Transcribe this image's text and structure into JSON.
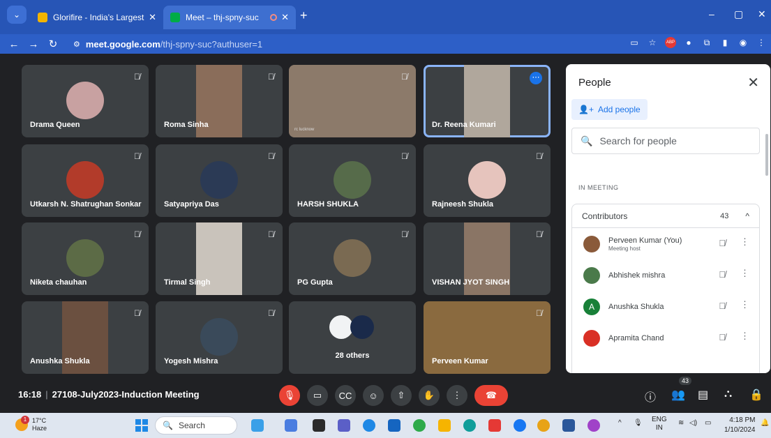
{
  "browser": {
    "tabs": [
      {
        "title": "Glorifire - India's Largest Online",
        "favicon_color": "#f2b400"
      },
      {
        "title": "Meet – thj-spny-suc",
        "favicon_color": "#00ac47"
      }
    ],
    "url_host": "meet.google.com",
    "url_path": "/thj-spny-suc?authuser=1",
    "extension_badge": "ABP"
  },
  "grid": {
    "tiles": [
      {
        "name": "Drama Queen",
        "kind": "avatar",
        "color": "#c8a1a1"
      },
      {
        "name": "Roma Sinha",
        "kind": "video",
        "color": "#8a6d5a"
      },
      {
        "name": "",
        "kind": "video-wide",
        "color": "#8c7a6a",
        "caption": "rc lucknow"
      },
      {
        "name": "Dr. Reena Kumari",
        "kind": "video",
        "color": "#b0a79c",
        "active": true
      },
      {
        "name": "Utkarsh N. Shatrughan Sonkar",
        "kind": "avatar",
        "color": "#b23b2a"
      },
      {
        "name": "Satyapriya Das",
        "kind": "avatar",
        "color": "#2b3a55"
      },
      {
        "name": "HARSH SHUKLA",
        "kind": "avatar",
        "color": "#566b4a"
      },
      {
        "name": "Rajneesh Shukla",
        "kind": "avatar",
        "color": "#e6c4bd"
      },
      {
        "name": "Niketa chauhan",
        "kind": "avatar",
        "color": "#5c6b46"
      },
      {
        "name": "Tirmal Singh",
        "kind": "video",
        "color": "#c9c3bb"
      },
      {
        "name": "PG Gupta",
        "kind": "avatar",
        "color": "#7a6a52"
      },
      {
        "name": "VISHAN JYOT SINGH",
        "kind": "video",
        "color": "#8a7565"
      },
      {
        "name": "Anushka Shukla",
        "kind": "video",
        "color": "#6b5040"
      },
      {
        "name": "Yogesh Mishra",
        "kind": "avatar",
        "color": "#3a4a5a"
      },
      {
        "name": "28 others",
        "kind": "others",
        "color": "#3c4043"
      },
      {
        "name": "Perveen Kumar",
        "kind": "video-wide",
        "color": "#8a6a3f"
      }
    ]
  },
  "people": {
    "title": "People",
    "add_label": "Add people",
    "search_placeholder": "Search for people",
    "in_meeting": "IN MEETING",
    "section": "Contributors",
    "count": "43",
    "list": [
      {
        "name": "Perveen Kumar (You)",
        "role": "Meeting host",
        "avatar_color": "#8a5a3a",
        "initial": ""
      },
      {
        "name": "Abhishek mishra",
        "role": "",
        "avatar_color": "#4a7a4a",
        "initial": ""
      },
      {
        "name": "Anushka Shukla",
        "role": "",
        "avatar_color": "#188038",
        "initial": "A"
      },
      {
        "name": "Apramita Chand",
        "role": "",
        "avatar_color": "#d93025",
        "initial": ""
      }
    ]
  },
  "bottom": {
    "time": "16:18",
    "meeting_name": "27108-July2023-Induction Meeting",
    "people_badge": "43"
  },
  "taskbar": {
    "temp": "17°C",
    "condition": "Haze",
    "search": "Search",
    "lang1": "ENG",
    "lang2": "IN",
    "time": "4:18 PM",
    "date": "1/10/2024"
  }
}
